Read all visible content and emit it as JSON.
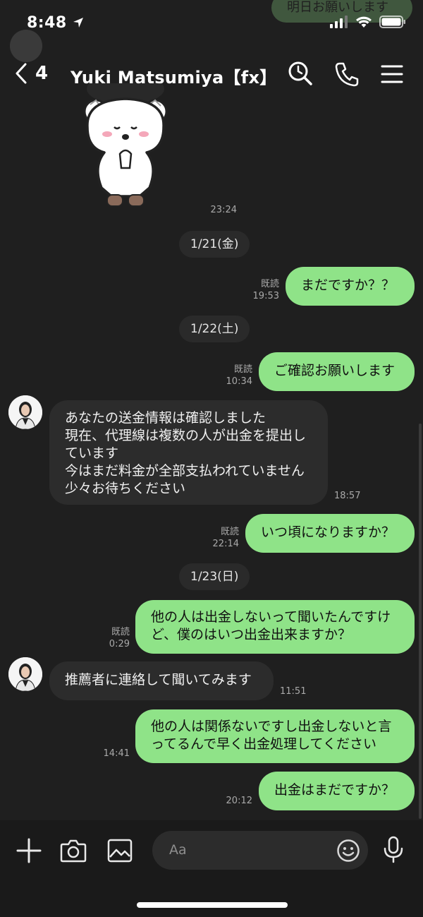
{
  "status": {
    "time": "8:48"
  },
  "ghost": {
    "text": "明日お願いします"
  },
  "header": {
    "back_count": "4",
    "title": "Yuki Matsumiya【fx】"
  },
  "sticker": {
    "time": "23:24"
  },
  "dates": [
    "1/21(金)",
    "1/22(土)",
    "1/23(日)"
  ],
  "messages": {
    "m1": {
      "text": "まだですか？？",
      "read": "既読",
      "time": "19:53"
    },
    "m2": {
      "text": "ご確認お願いします",
      "read": "既読",
      "time": "10:34"
    },
    "m3": {
      "lines": [
        "あなたの送金情報は確認しました",
        "現在、代理線は複数の人が出金を提出し",
        "ています",
        "今はまだ料金が全部支払われていません",
        "少々お待ちください"
      ],
      "time": "18:57"
    },
    "m4": {
      "text": "いつ頃になりますか？",
      "read": "既読",
      "time": "22:14"
    },
    "m5": {
      "lines": [
        "他の人は出金しないって聞いたんですけ",
        "ど、僕のはいつ出金出来ますか？"
      ],
      "read": "既読",
      "time": "0:29"
    },
    "m6": {
      "text": "推薦者に連絡して聞いてみます",
      "time": "11:51"
    },
    "m7": {
      "lines": [
        "他の人は関係ないですし出金しないと言",
        "ってるんで早く出金処理してください"
      ],
      "time": "14:41"
    },
    "m8": {
      "text": "出金はまだですか？",
      "time": "20:12"
    }
  },
  "input": {
    "placeholder": "Aa"
  },
  "colors": {
    "outgoing": "#8fe388",
    "incoming": "#2c2c2c",
    "background": "#1f1f1f"
  }
}
